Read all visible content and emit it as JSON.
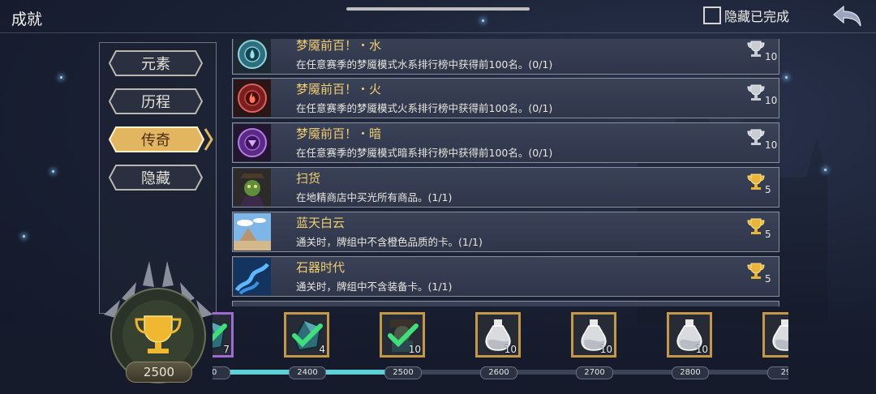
{
  "header": {
    "title": "成就",
    "hide_completed_label": "隐藏已完成",
    "hide_completed_checked": false
  },
  "categories": [
    {
      "label": "元素",
      "active": false
    },
    {
      "label": "历程",
      "active": false
    },
    {
      "label": "传奇",
      "active": true
    },
    {
      "label": "隐藏",
      "active": false
    }
  ],
  "achievements": [
    {
      "title": "梦魇前百！・水",
      "desc": "在任意赛季的梦魇模式水系排行榜中获得前100名。(0/1)",
      "points": "10",
      "icon": "water-medal-icon",
      "trophy": "silver"
    },
    {
      "title": "梦魇前百！・火",
      "desc": "在任意赛季的梦魇模式火系排行榜中获得前100名。(0/1)",
      "points": "10",
      "icon": "fire-medal-icon",
      "trophy": "silver"
    },
    {
      "title": "梦魇前百！・暗",
      "desc": "在任意赛季的梦魇模式暗系排行榜中获得前100名。(0/1)",
      "points": "10",
      "icon": "dark-medal-icon",
      "trophy": "silver"
    },
    {
      "title": "扫货",
      "desc": "在地精商店中买光所有商品。(1/1)",
      "points": "5",
      "icon": "goblin-merchant-icon",
      "trophy": "gold"
    },
    {
      "title": "蓝天白云",
      "desc": "通关时，牌组中不含橙色品质的卡。(1/1)",
      "points": "5",
      "icon": "desert-sky-icon",
      "trophy": "gold"
    },
    {
      "title": "石器时代",
      "desc": "通关时，牌组中不含装备卡。(1/1)",
      "points": "5",
      "icon": "stone-age-icon",
      "trophy": "gold"
    }
  ],
  "total_score": "2500",
  "progress": {
    "current": 2500,
    "ticks": [
      "00",
      "2400",
      "2500",
      "2600",
      "2700",
      "2800",
      "29"
    ],
    "rewards": [
      {
        "count": "7",
        "claimed": true,
        "icon": "teal-gem-icon"
      },
      {
        "count": "4",
        "claimed": true,
        "icon": "teal-gem-icon"
      },
      {
        "count": "10",
        "claimed": true,
        "icon": "dark-item-icon"
      },
      {
        "count": "10",
        "claimed": false,
        "icon": "potion-bottle-icon"
      },
      {
        "count": "10",
        "claimed": false,
        "icon": "potion-bottle-icon"
      },
      {
        "count": "10",
        "claimed": false,
        "icon": "potion-bottle-icon"
      },
      {
        "count": "",
        "claimed": false,
        "icon": "potion-bottle-icon"
      }
    ]
  },
  "colors": {
    "gold_title": "#f1cd6e",
    "progress_fill": "#5fd0d6",
    "reward_frame": "#c49846"
  }
}
